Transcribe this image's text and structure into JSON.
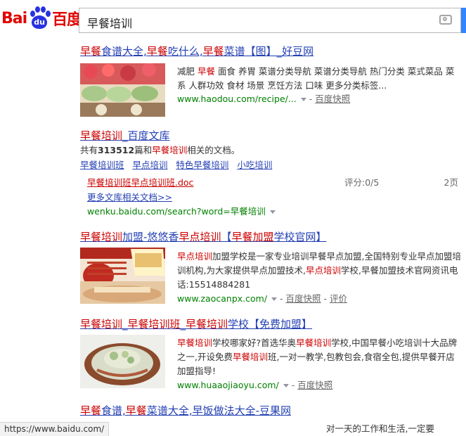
{
  "search": {
    "query": "早餐培训"
  },
  "logo": {
    "text_a": "Bai",
    "text_paw": "du",
    "text_b": "百度"
  },
  "results": [
    {
      "title_parts": [
        "早餐",
        "食谱大全,",
        "早餐",
        "吃什么,",
        "早餐",
        "菜谱【图】_好豆网"
      ],
      "abstract_parts": [
        "减肥 ",
        "早餐",
        " 面食 养胃 菜谱分类导航 菜谱分类导航 热门分类 菜式菜品 菜系 人群功效 食材 场景 烹饪方法 口味 更多分类标签..."
      ],
      "url": "www.haodou.com/recipe/...",
      "snapshot": "百度快照"
    },
    {
      "title_parts": [
        "早餐培训",
        "_百度文库"
      ],
      "count_line_parts": [
        "共有",
        "313512",
        "篇和",
        "早餐培训",
        "相关的文档。"
      ],
      "tags": [
        "早餐培训班",
        "早点培训",
        "特色早餐培训",
        "小吃培训"
      ],
      "doc_title": "早餐培训班早点培训班.doc",
      "doc_score": "评分:0/5",
      "doc_pages": "2页",
      "more_docs": "更多文库相关文档>>",
      "url_prefix": "wenku.baidu.com/search?word=",
      "url_kw": "早餐培训"
    },
    {
      "title_parts": [
        "早餐培训",
        "加盟-悠悠香",
        "早点培训",
        "【",
        "早餐加盟",
        "学校官网】"
      ],
      "abstract_parts": [
        "早点培训",
        "加盟学校是一家专业培训早餐早点加盟,全国特别专业早点加盟培训机构,为大家提供早点加盟技术,",
        "早点培训",
        "学校,早餐加盟技术官网资讯电话:15514884281"
      ],
      "url": "www.zaocanpx.com/",
      "snapshot": "百度快照",
      "review": "评价"
    },
    {
      "title_parts": [
        "早餐培训",
        "_",
        "早餐培训班",
        "_",
        "早餐培训",
        "学校【免费加盟】"
      ],
      "abstract_parts": [
        "早餐培训",
        "学校哪家好?首选华奥",
        "早餐培训",
        "学校,中国早餐小吃培训十大品牌之一,开设免费",
        "早餐培训",
        "班,一对一教学,包教包会,食宿全包,提供早餐开店加盟指导!"
      ],
      "url": "www.huaaojiaoyu.com/",
      "snapshot": "百度快照"
    },
    {
      "title_parts": [
        "早餐",
        "食谱,",
        "早餐",
        "菜谱大全,早饭做法大全-豆果网"
      ],
      "abstract_tail": "对一天的工作和生活,一定要"
    }
  ],
  "status_bar": "https://www.baidu.com/",
  "colors": {
    "brand_red": "#e10602",
    "brand_blue": "#2932e1",
    "link": "#2440b3",
    "highlight": "#c00",
    "url_green": "#008000"
  }
}
